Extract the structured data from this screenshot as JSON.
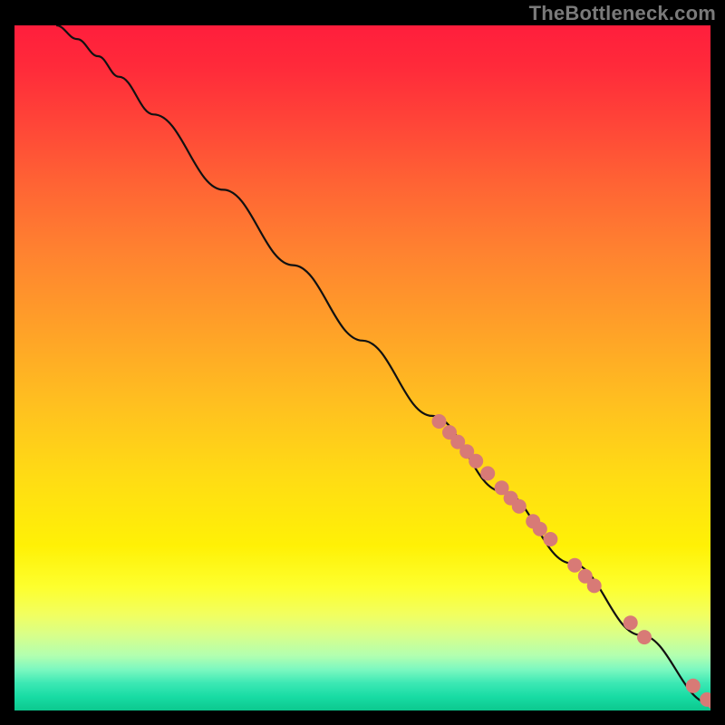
{
  "watermark": "TheBottleneck.com",
  "colors": {
    "background": "#000000",
    "curve": "#111111",
    "points": "#d87a76",
    "gradient_top": "#ff1e3c",
    "gradient_mid": "#ffdc14",
    "gradient_bottom": "#0cc88e"
  },
  "chart_data": {
    "type": "line",
    "title": "",
    "xlabel": "",
    "ylabel": "",
    "xlim": [
      0,
      100
    ],
    "ylim": [
      0,
      100
    ],
    "grid": false,
    "legend": false,
    "curve": [
      {
        "x": 6,
        "y": 100
      },
      {
        "x": 9,
        "y": 98
      },
      {
        "x": 12,
        "y": 95.5
      },
      {
        "x": 15,
        "y": 92.5
      },
      {
        "x": 20,
        "y": 87
      },
      {
        "x": 30,
        "y": 76
      },
      {
        "x": 40,
        "y": 65
      },
      {
        "x": 50,
        "y": 54
      },
      {
        "x": 60,
        "y": 43
      },
      {
        "x": 70,
        "y": 32
      },
      {
        "x": 80,
        "y": 21.5
      },
      {
        "x": 90,
        "y": 11
      },
      {
        "x": 100,
        "y": 1
      }
    ],
    "points": [
      {
        "x": 61,
        "y": 42.2
      },
      {
        "x": 62.5,
        "y": 40.6
      },
      {
        "x": 63.7,
        "y": 39.2
      },
      {
        "x": 65,
        "y": 37.8
      },
      {
        "x": 66.3,
        "y": 36.4
      },
      {
        "x": 68,
        "y": 34.6
      },
      {
        "x": 70,
        "y": 32.5
      },
      {
        "x": 71.3,
        "y": 31.0
      },
      {
        "x": 72.5,
        "y": 29.8
      },
      {
        "x": 74.5,
        "y": 27.6
      },
      {
        "x": 75.5,
        "y": 26.5
      },
      {
        "x": 77,
        "y": 25.0
      },
      {
        "x": 80.5,
        "y": 21.2
      },
      {
        "x": 82,
        "y": 19.6
      },
      {
        "x": 83.3,
        "y": 18.2
      },
      {
        "x": 88.5,
        "y": 12.8
      },
      {
        "x": 90.5,
        "y": 10.7
      },
      {
        "x": 97.5,
        "y": 3.6
      },
      {
        "x": 99.5,
        "y": 1.6
      },
      {
        "x": 100.5,
        "y": 1.2
      }
    ]
  }
}
